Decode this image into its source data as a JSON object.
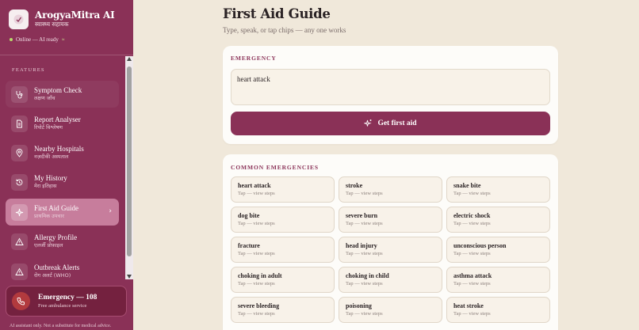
{
  "app": {
    "title": "ArogyaMitra AI",
    "subtitle": "स्वास्थ्य सहायक",
    "status": "Online — AI ready",
    "status_extra": "≈"
  },
  "sidebar": {
    "section_label": "FEATURES",
    "items": [
      {
        "label": "Symptom Check",
        "hindi": "लक्षण जाँच",
        "icon": "stethoscope-icon"
      },
      {
        "label": "Report Analyser",
        "hindi": "रिपोर्ट विश्लेषण",
        "icon": "document-icon"
      },
      {
        "label": "Nearby Hospitals",
        "hindi": "नज़दीकी अस्पताल",
        "icon": "map-pin-icon"
      },
      {
        "label": "My History",
        "hindi": "मेरा इतिहास",
        "icon": "history-icon"
      },
      {
        "label": "First Aid Guide",
        "hindi": "प्राथमिक उपचार",
        "icon": "sparkle-icon",
        "active": true,
        "chevron": "›"
      },
      {
        "label": "Allergy Profile",
        "hindi": "एलर्जी प्रोफ़ाइल",
        "icon": "warning-icon"
      },
      {
        "label": "Outbreak Alerts",
        "hindi": "रोग अलर्ट (WHO)",
        "icon": "alert-icon"
      }
    ],
    "emergency": {
      "title": "Emergency — 108",
      "subtitle": "Free ambulance service",
      "icon": "phone-icon"
    },
    "disclaimer": "AI assistant only. Not a substitute for medical advice."
  },
  "main": {
    "title": "First Aid Guide",
    "subtitle": "Type, speak, or tap chips — any one works",
    "emergency_card": {
      "label": "EMERGENCY",
      "input_value": "heart attack",
      "button_label": "Get first aid",
      "button_icon": "sparkle-icon"
    },
    "common_card": {
      "label": "COMMON EMERGENCIES",
      "chips": [
        {
          "title": "heart attack",
          "hint": "Tap — view steps"
        },
        {
          "title": "stroke",
          "hint": "Tap — view steps"
        },
        {
          "title": "snake bite",
          "hint": "Tap — view steps"
        },
        {
          "title": "dog bite",
          "hint": "Tap — view steps"
        },
        {
          "title": "severe burn",
          "hint": "Tap — view steps"
        },
        {
          "title": "electric shock",
          "hint": "Tap — view steps"
        },
        {
          "title": "fracture",
          "hint": "Tap — view steps"
        },
        {
          "title": "head injury",
          "hint": "Tap — view steps"
        },
        {
          "title": "unconscious person",
          "hint": "Tap — view steps"
        },
        {
          "title": "choking in adult",
          "hint": "Tap — view steps"
        },
        {
          "title": "choking in child",
          "hint": "Tap — view steps"
        },
        {
          "title": "asthma attack",
          "hint": "Tap — view steps"
        },
        {
          "title": "severe bleeding",
          "hint": "Tap — view steps"
        },
        {
          "title": "poisoning",
          "hint": "Tap — view steps"
        },
        {
          "title": "heat stroke",
          "hint": "Tap — view steps"
        }
      ]
    }
  },
  "colors": {
    "sidebar": "#8a3157",
    "accent": "#8a3157",
    "page_bg": "#f0e8da",
    "card_bg": "#fdfcf9",
    "emergency_icon": "#b23a3e"
  }
}
